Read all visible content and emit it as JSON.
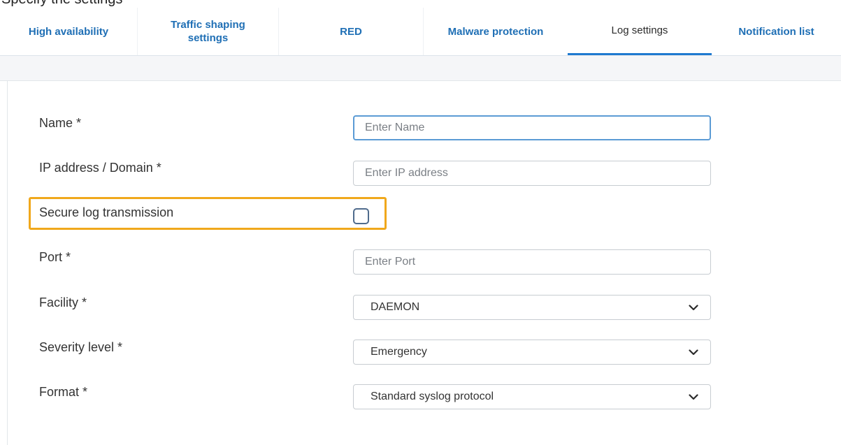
{
  "header": {
    "title_partial": "Specify the settings"
  },
  "tabs": [
    {
      "label": "High availability"
    },
    {
      "label_line1": "Traffic shaping",
      "label_line2": "settings"
    },
    {
      "label": "RED"
    },
    {
      "label": "Malware protection"
    },
    {
      "label": "Log settings",
      "active": true
    },
    {
      "label": "Notification list"
    }
  ],
  "form": {
    "name": {
      "label": "Name *",
      "placeholder": "Enter Name",
      "value": ""
    },
    "ip": {
      "label": "IP address / Domain *",
      "placeholder": "Enter IP address",
      "value": ""
    },
    "secure": {
      "label": "Secure log transmission",
      "checked": false
    },
    "port": {
      "label": "Port *",
      "placeholder": "Enter Port",
      "value": ""
    },
    "facility": {
      "label": "Facility *",
      "value": "DAEMON"
    },
    "severity": {
      "label": "Severity level *",
      "value": "Emergency"
    },
    "format": {
      "label": "Format *",
      "value": "Standard syslog protocol"
    }
  },
  "colors": {
    "link_tab": "#1f6fb5",
    "active_underline": "#1f7ad0",
    "highlight_box": "#f0a81c"
  },
  "icons": {
    "select_arrow": "chevron-down-icon"
  }
}
